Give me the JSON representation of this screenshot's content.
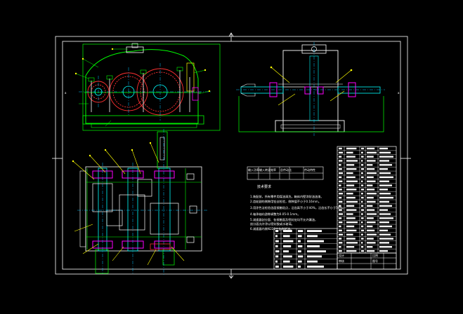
{
  "viewport": {
    "background": "#000000"
  },
  "colors": {
    "border": "#ffffff",
    "housing": "#00ff00",
    "gear": "#ff3030",
    "shaft": "#00ffff",
    "bearing": "#ff00ff",
    "leader": "#ffff00",
    "center": "#00bfff",
    "fastener": "#ffffff"
  },
  "drawing": {
    "technical_requirements_title": "技术要求",
    "technical_requirements": [
      "1.装配前，所有零件用煤油清洗，箱体内壁涂耐油油漆。",
      "2.齿轮副的侧隙用铅丝检验，侧隙值不小于0.16mm。",
      "3.用涂色法检验齿面接触斑点，沿齿高不小于40%，沿齿长不小于50%。",
      "4.轴承轴向游隙调整为0.05-0.1mm。",
      "5.减速器剖分面、各接触面及密封处均不允许漏油，",
      "  剖分面允许涂以密封胶或水玻璃。",
      "6.减速器内装N220工业齿轮油。"
    ],
    "characteristics_table": {
      "headers": [
        "输入功率",
        "输入转速",
        "效率",
        "总传动比",
        "传动特性"
      ],
      "row": [
        "",
        "",
        "",
        "",
        ""
      ]
    },
    "bom_table": {
      "columns": [
        "序号",
        "名称",
        "数量",
        "材料",
        "备注"
      ],
      "row_count": 26
    },
    "title_block": {
      "label_design": "设计",
      "label_check": "审核",
      "label_scale": "比例",
      "label_sheet": "图号",
      "name": ""
    }
  }
}
